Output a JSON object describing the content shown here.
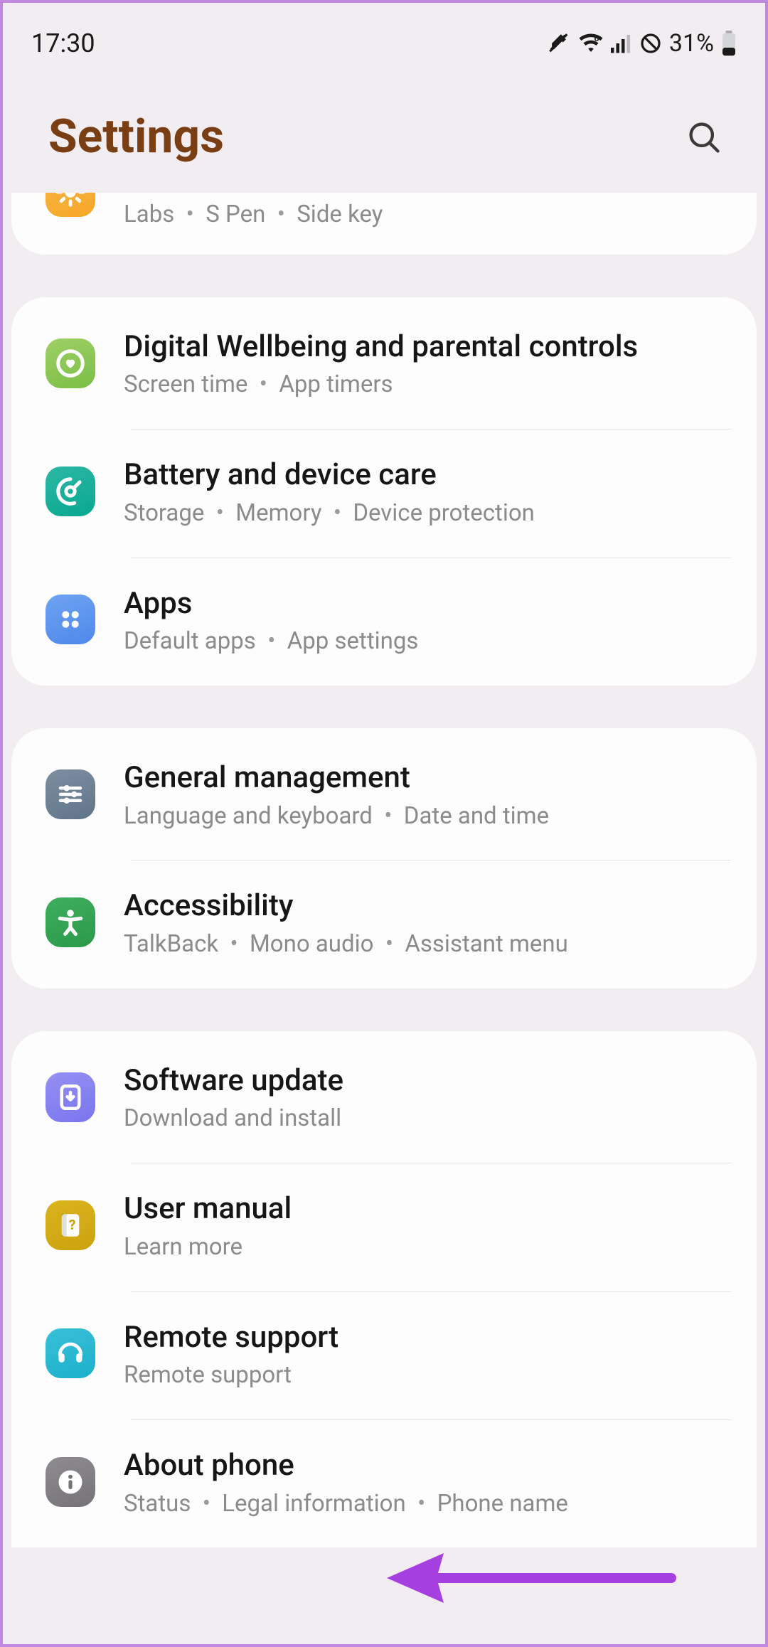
{
  "status": {
    "time": "17:30",
    "battery": "31%"
  },
  "header": {
    "title": "Settings"
  },
  "groups": [
    {
      "partial": true,
      "items": [
        {
          "icon": "advanced",
          "colors": [
            "#f8b54a",
            "#f6a826"
          ],
          "title": "",
          "subtitle_parts": [
            "Labs",
            "S Pen",
            "Side key"
          ]
        }
      ]
    },
    {
      "items": [
        {
          "icon": "wellbeing",
          "colors": [
            "#9fcf66",
            "#7abf45"
          ],
          "title": "Digital Wellbeing and parental controls",
          "subtitle_parts": [
            "Screen time",
            "App timers"
          ]
        },
        {
          "icon": "devicecare",
          "colors": [
            "#2bb7a3",
            "#0aa890"
          ],
          "title": "Battery and device care",
          "subtitle_parts": [
            "Storage",
            "Memory",
            "Device protection"
          ]
        },
        {
          "icon": "apps",
          "colors": [
            "#6fa3f2",
            "#4e88ea"
          ],
          "title": "Apps",
          "subtitle_parts": [
            "Default apps",
            "App settings"
          ]
        }
      ]
    },
    {
      "items": [
        {
          "icon": "general",
          "colors": [
            "#7d8fa1",
            "#5f7588"
          ],
          "title": "General management",
          "subtitle_parts": [
            "Language and keyboard",
            "Date and time"
          ]
        },
        {
          "icon": "accessibility",
          "colors": [
            "#3fae5f",
            "#2a9a4a"
          ],
          "title": "Accessibility",
          "subtitle_parts": [
            "TalkBack",
            "Mono audio",
            "Assistant menu"
          ]
        }
      ]
    },
    {
      "last": true,
      "items": [
        {
          "icon": "update",
          "colors": [
            "#9490f3",
            "#7a75ee"
          ],
          "title": "Software update",
          "subtitle_parts": [
            "Download and install"
          ]
        },
        {
          "icon": "manual",
          "colors": [
            "#dbb31c",
            "#caa30e"
          ],
          "title": "User manual",
          "subtitle_parts": [
            "Learn more"
          ]
        },
        {
          "icon": "remote",
          "colors": [
            "#38c0d8",
            "#1db0ca"
          ],
          "title": "Remote support",
          "subtitle_parts": [
            "Remote support"
          ]
        },
        {
          "icon": "about",
          "colors": [
            "#8e8c90",
            "#757378"
          ],
          "title": "About phone",
          "subtitle_parts": [
            "Status",
            "Legal information",
            "Phone name"
          ]
        }
      ]
    }
  ]
}
